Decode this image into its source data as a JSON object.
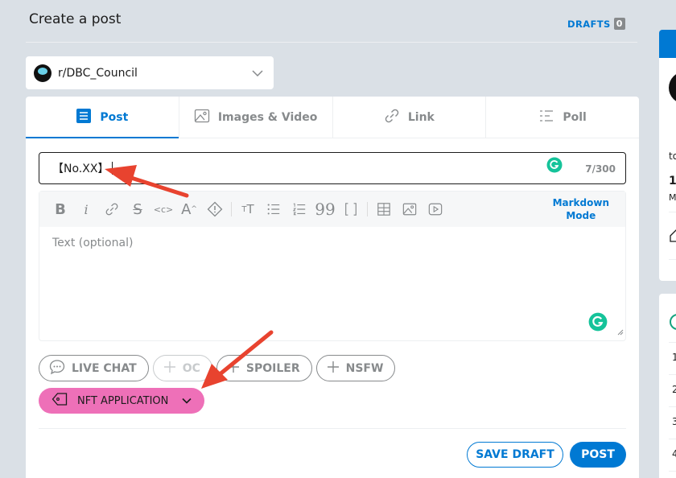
{
  "header": {
    "title": "Create a post",
    "drafts_label": "DRAFTS",
    "drafts_count": "0"
  },
  "community": {
    "name": "r/DBC_Council"
  },
  "tabs": [
    {
      "label": "Post",
      "icon": "post-icon",
      "active": true
    },
    {
      "label": "Images & Video",
      "icon": "image-icon"
    },
    {
      "label": "Link",
      "icon": "link-icon"
    },
    {
      "label": "Poll",
      "icon": "poll-icon"
    }
  ],
  "title_field": {
    "value": "【No.XX】",
    "counter": "7/300"
  },
  "editor": {
    "markdown_line1": "Markdown",
    "markdown_line2": "Mode",
    "placeholder": "Text (optional)"
  },
  "chips": {
    "live_chat": "LIVE CHAT",
    "oc": "OC",
    "spoiler": "SPOILER",
    "nsfw": "NSFW"
  },
  "flair": {
    "label": "NFT APPLICATION",
    "color": "#ee70b8"
  },
  "actions": {
    "save_draft": "SAVE DRAFT",
    "post": "POST"
  },
  "sidebar": {
    "t1": "to",
    "t2": "1",
    "t3": "M",
    "numbers": [
      "1",
      "2",
      "3",
      "4"
    ]
  },
  "colors": {
    "accent": "#0079d3",
    "annotation_arrow": "#e8432f"
  }
}
